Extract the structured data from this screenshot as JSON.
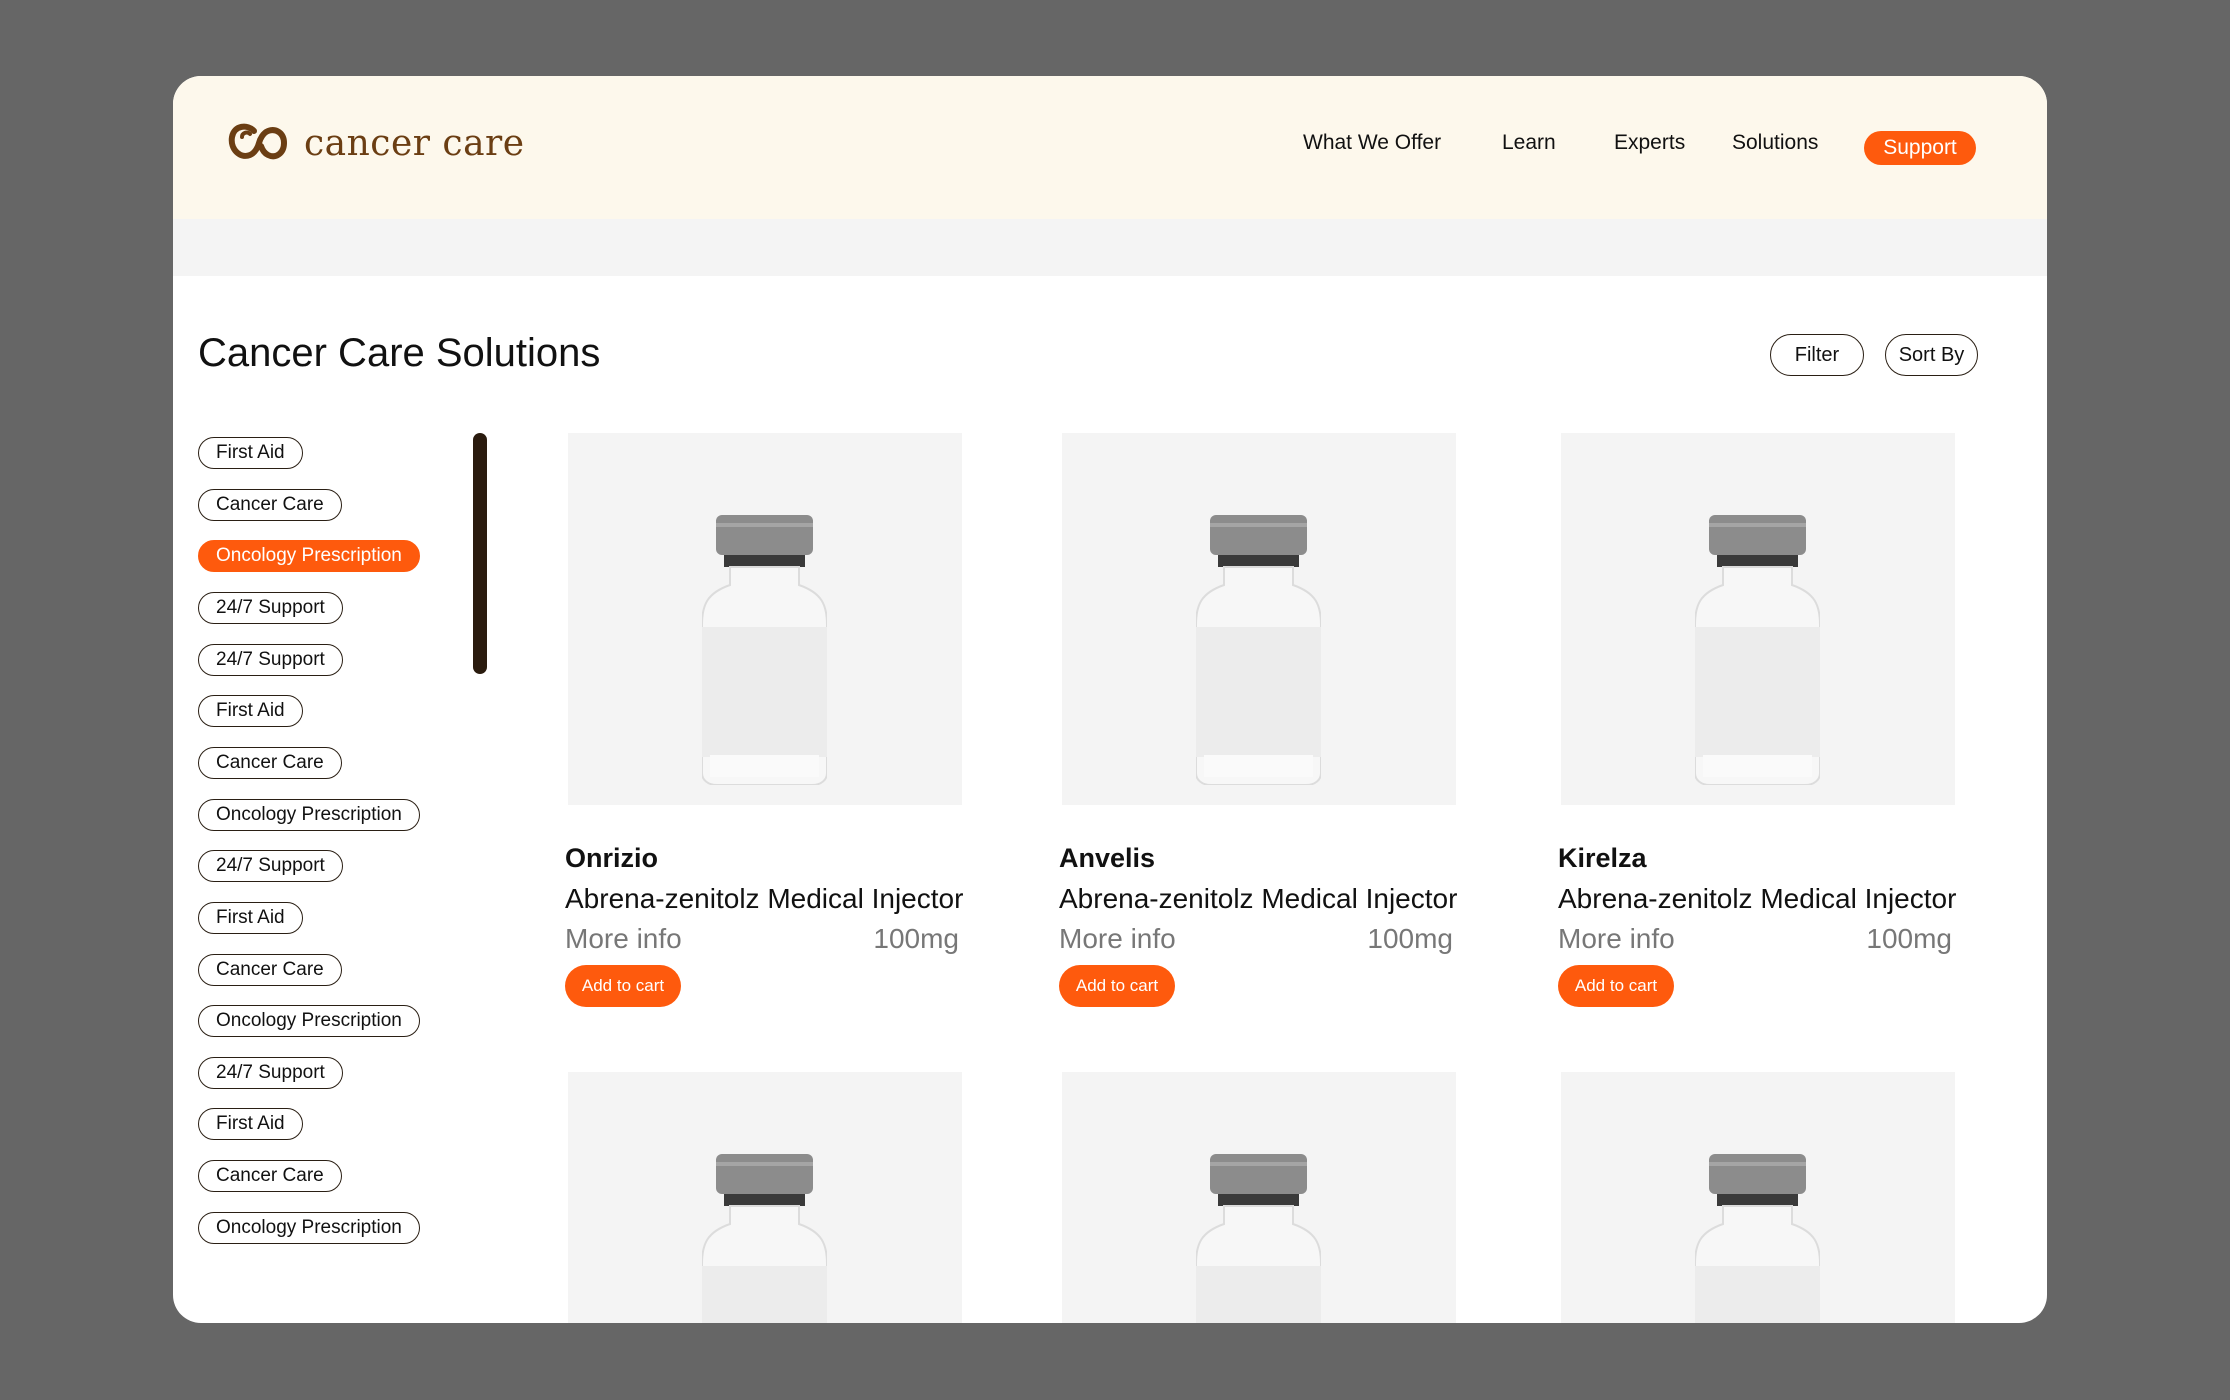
{
  "brand": {
    "name": "cancer care",
    "accent": "#fe5a0d",
    "brown": "#6b3e13"
  },
  "nav": {
    "items": [
      "What We Offer",
      "Learn",
      "Experts",
      "Solutions"
    ],
    "support_label": "Support"
  },
  "page": {
    "title": "Cancer Care Solutions",
    "filter_label": "Filter",
    "sort_label": "Sort By"
  },
  "sidebar": {
    "active_index": 2,
    "items": [
      "First Aid",
      "Cancer Care",
      "Oncology  Prescription",
      "24/7 Support",
      "24/7 Support",
      "First Aid",
      "Cancer Care",
      "Oncology  Prescription",
      "24/7 Support",
      "First Aid",
      "Cancer Care",
      "Oncology  Prescription",
      "24/7 Support",
      "First Aid",
      "Cancer Care",
      "Oncology  Prescription"
    ]
  },
  "products": [
    {
      "name": "Onrizio",
      "description": "Abrena-zenitolz Medical Injector",
      "more": "More info",
      "dose": "100mg",
      "cart": "Add to cart",
      "image": "vial-icon"
    },
    {
      "name": "Anvelis",
      "description": "Abrena-zenitolz Medical Injector",
      "more": "More info",
      "dose": "100mg",
      "cart": "Add to cart",
      "image": "vial-icon"
    },
    {
      "name": "Kirelza",
      "description": "Abrena-zenitolz Medical Injector",
      "more": "More info",
      "dose": "100mg",
      "cart": "Add to cart",
      "image": "vial-icon"
    },
    {
      "image": "vial-icon"
    },
    {
      "image": "vial-icon"
    },
    {
      "image": "vial-icon"
    }
  ]
}
